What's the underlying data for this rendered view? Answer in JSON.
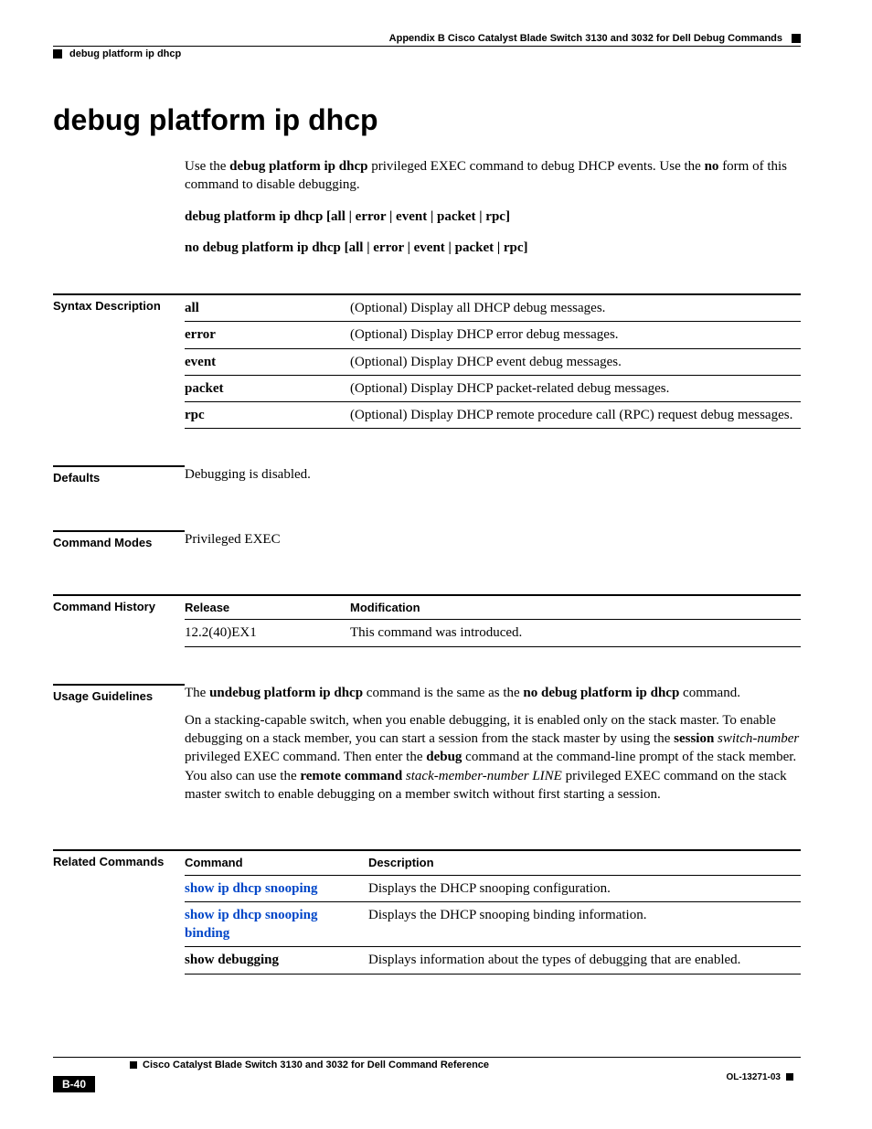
{
  "header": {
    "appendix": "Appendix B      Cisco Catalyst Blade Switch 3130 and 3032 for Dell Debug Commands",
    "crumb": "debug platform ip dhcp"
  },
  "title": "debug platform ip dhcp",
  "intro": {
    "p1_pre": "Use the ",
    "p1_b1": "debug platform ip dhcp",
    "p1_mid": " privileged EXEC command to debug DHCP events. Use the ",
    "p1_b2": "no",
    "p1_post": " form of this command to disable debugging.",
    "syntax1": "debug platform ip dhcp [all | error | event | packet | rpc]",
    "syntax2": "no debug platform ip dhcp [all | error | event | packet | rpc]"
  },
  "sections": {
    "syntax_desc_label": "Syntax Description",
    "defaults_label": "Defaults",
    "defaults_text": "Debugging is disabled.",
    "modes_label": "Command Modes",
    "modes_text": "Privileged EXEC",
    "history_label": "Command History",
    "usage_label": "Usage Guidelines",
    "related_label": "Related Commands"
  },
  "syntax_rows": [
    {
      "k": "all",
      "v": "(Optional) Display all DHCP debug messages."
    },
    {
      "k": "error",
      "v": "(Optional) Display DHCP error debug messages."
    },
    {
      "k": "event",
      "v": "(Optional) Display DHCP event debug messages."
    },
    {
      "k": "packet",
      "v": "(Optional) Display DHCP packet-related debug messages."
    },
    {
      "k": "rpc",
      "v": "(Optional) Display DHCP remote procedure call (RPC) request debug messages."
    }
  ],
  "history": {
    "h1": "Release",
    "h2": "Modification",
    "rows": [
      {
        "r": "12.2(40)EX1",
        "m": "This command was introduced."
      }
    ]
  },
  "usage": {
    "p1_a": "The ",
    "p1_b": "undebug platform ip dhcp",
    "p1_c": " command is the same as the ",
    "p1_d": "no debug platform ip dhcp",
    "p1_e": " command.",
    "p2_a": "On a stacking-capable switch, when you enable debugging, it is enabled only on the stack master. To enable debugging on a stack member, you can start a session from the stack master by using the ",
    "p2_b": "session",
    "p2_c": " ",
    "p2_d": "switch-number",
    "p2_e": " privileged EXEC command. Then enter the ",
    "p2_f": "debug",
    "p2_g": " command at the command-line prompt of the stack member. You also can use the ",
    "p2_h": "remote command",
    "p2_i": " ",
    "p2_j": "stack-member-number LINE",
    "p2_k": " privileged EXEC command on the stack master switch to enable debugging on a member switch without first starting a session."
  },
  "related": {
    "h1": "Command",
    "h2": "Description",
    "rows": [
      {
        "c": "show ip dhcp snooping",
        "link": true,
        "d": "Displays the DHCP snooping configuration."
      },
      {
        "c": "show ip dhcp snooping binding",
        "link": true,
        "d": "Displays the DHCP snooping binding information."
      },
      {
        "c": "show debugging",
        "link": false,
        "d": "Displays information about the types of debugging that are enabled."
      }
    ]
  },
  "footer": {
    "title": "Cisco Catalyst Blade Switch 3130 and 3032 for Dell Command Reference",
    "page": "B-40",
    "doc": "OL-13271-03"
  }
}
